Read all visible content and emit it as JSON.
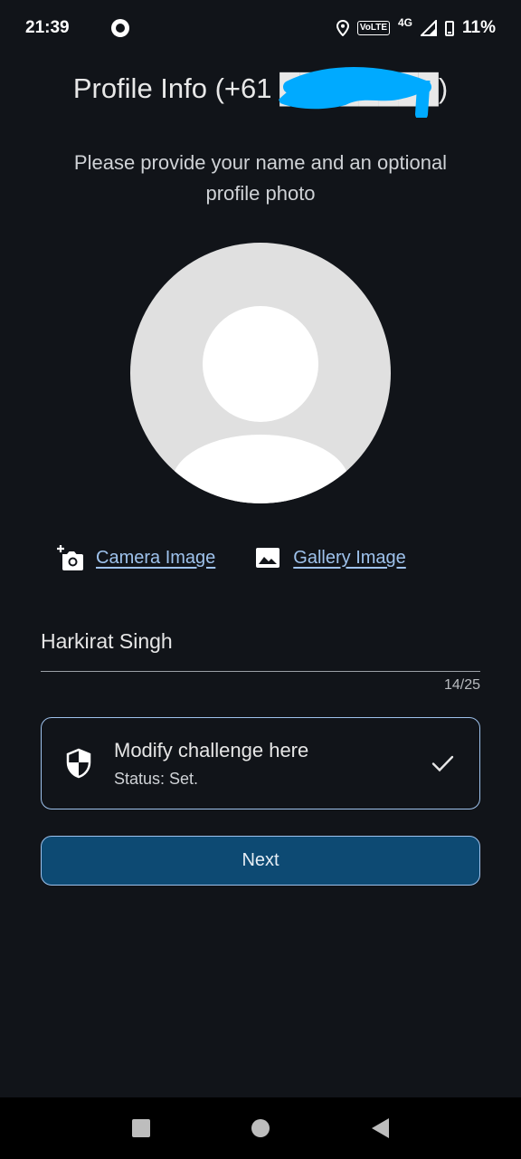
{
  "status_bar": {
    "time": "21:39",
    "volte": "VoLTE",
    "network": "4G",
    "battery": "11%"
  },
  "header": {
    "title": "Profile Info (+61 ████████)",
    "subtitle": "Please provide your name and an optional profile photo"
  },
  "image_options": {
    "camera_label": "Camera Image",
    "gallery_label": "Gallery Image"
  },
  "name_field": {
    "value": "Harkirat Singh",
    "counter": "14/25"
  },
  "challenge": {
    "title": "Modify challenge here",
    "status": "Status: Set."
  },
  "actions": {
    "next_label": "Next"
  },
  "colors": {
    "background": "#111419",
    "accent": "#9ec2ec",
    "button_fill": "#0d4a73",
    "redaction": "#00aaff"
  }
}
